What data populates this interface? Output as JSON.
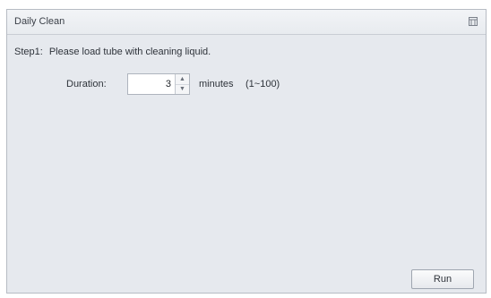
{
  "window": {
    "title": "Daily Clean"
  },
  "icons": {
    "maximize": "maximize-icon",
    "spin_up": "spin-up-icon",
    "spin_down": "spin-down-icon"
  },
  "step": {
    "label": "Step1:",
    "instruction": "Please load tube with cleaning liquid."
  },
  "duration": {
    "label": "Duration:",
    "value": "3",
    "unit_label": "minutes",
    "range_label": "(1~100)"
  },
  "actions": {
    "run_label": "Run"
  }
}
